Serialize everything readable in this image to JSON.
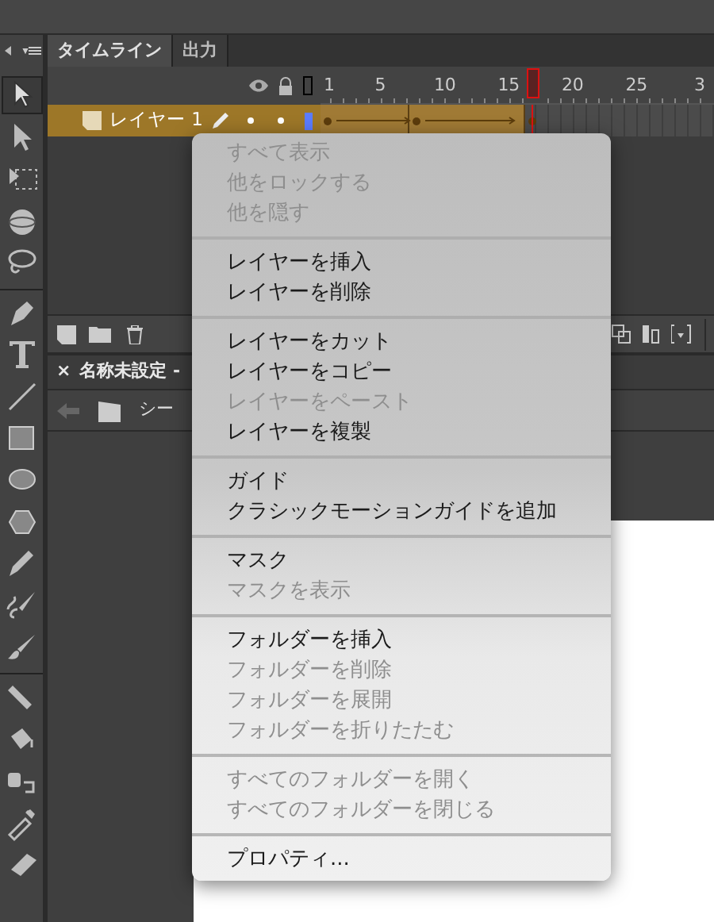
{
  "timeline": {
    "tabs": [
      {
        "label": "タイムライン",
        "selected": true
      },
      {
        "label": "出力",
        "selected": false
      }
    ],
    "ruler_labels": [
      "1",
      "5",
      "10",
      "15",
      "20",
      "25",
      "3"
    ],
    "layers": [
      {
        "name": "レイヤー 1",
        "selected": true
      }
    ]
  },
  "document": {
    "tab_label": "名称未設定 -",
    "close": "×",
    "scene": "シー"
  },
  "context_menu": {
    "groups": [
      [
        {
          "label": "すべて表示",
          "disabled": true
        },
        {
          "label": "他をロックする",
          "disabled": true
        },
        {
          "label": "他を隠す",
          "disabled": true
        }
      ],
      [
        {
          "label": "レイヤーを挿入",
          "disabled": false
        },
        {
          "label": "レイヤーを削除",
          "disabled": false
        }
      ],
      [
        {
          "label": "レイヤーをカット",
          "disabled": false
        },
        {
          "label": "レイヤーをコピー",
          "disabled": false
        },
        {
          "label": "レイヤーをペースト",
          "disabled": true
        },
        {
          "label": "レイヤーを複製",
          "disabled": false
        }
      ],
      [
        {
          "label": "ガイド",
          "disabled": false
        },
        {
          "label": "クラシックモーションガイドを追加",
          "disabled": false
        }
      ],
      [
        {
          "label": "マスク",
          "disabled": false
        },
        {
          "label": "マスクを表示",
          "disabled": true
        }
      ],
      [
        {
          "label": "フォルダーを挿入",
          "disabled": false
        },
        {
          "label": "フォルダーを削除",
          "disabled": true
        },
        {
          "label": "フォルダーを展開",
          "disabled": true
        },
        {
          "label": "フォルダーを折りたたむ",
          "disabled": true
        }
      ],
      [
        {
          "label": "すべてのフォルダーを開く",
          "disabled": true
        },
        {
          "label": "すべてのフォルダーを閉じる",
          "disabled": true
        }
      ],
      [
        {
          "label": "プロパティ...",
          "disabled": false
        }
      ]
    ]
  }
}
